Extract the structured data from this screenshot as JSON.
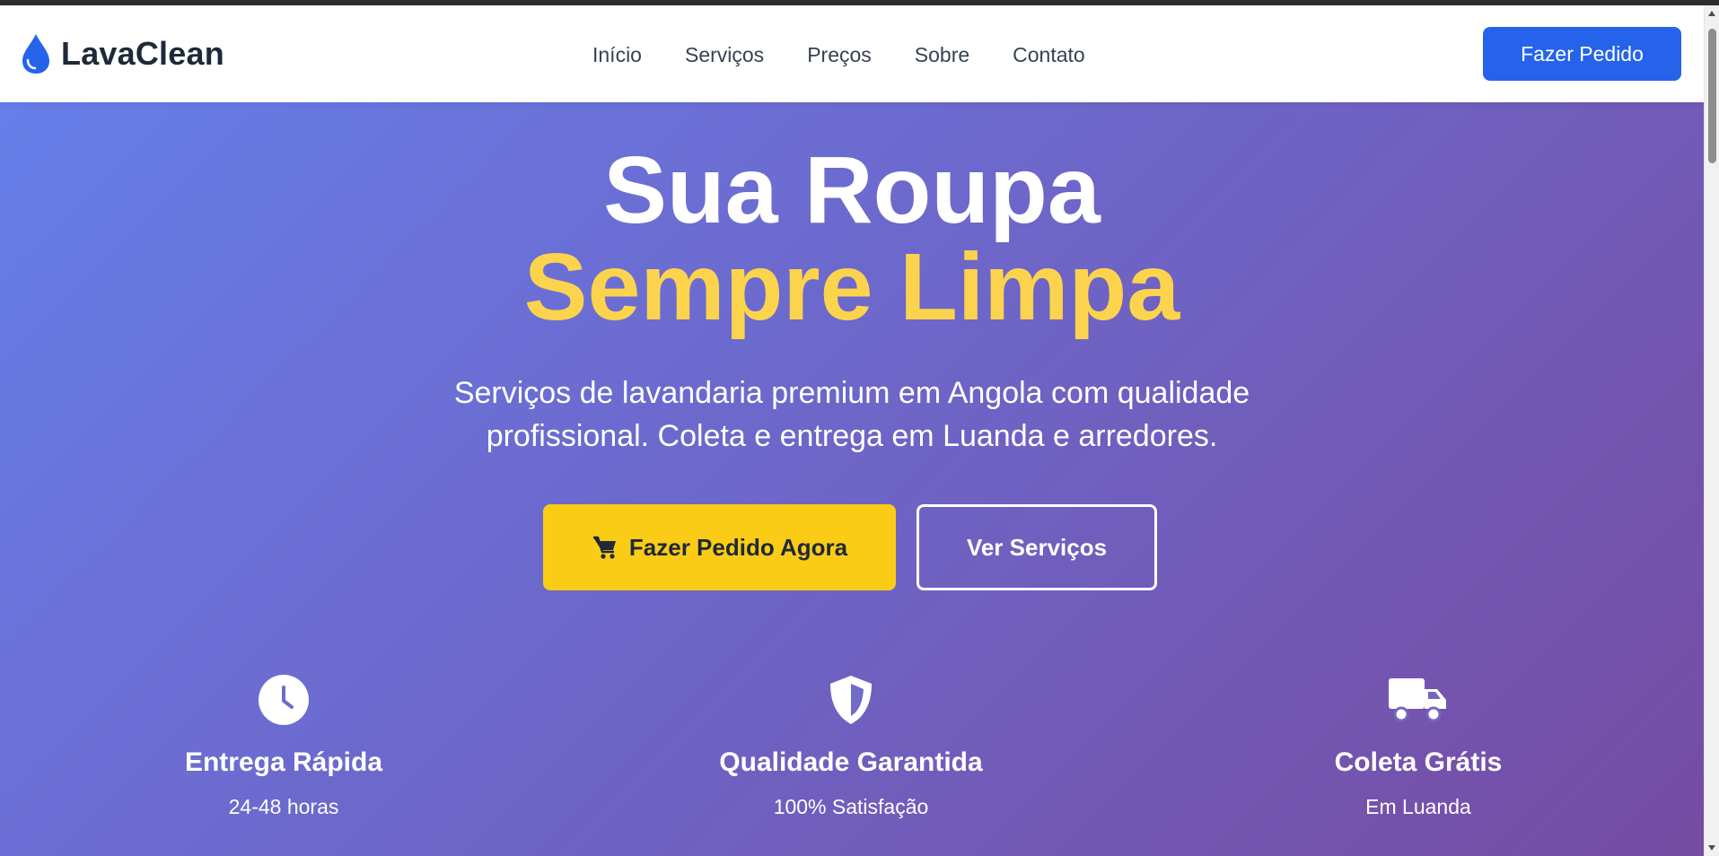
{
  "brand": {
    "name": "LavaClean",
    "icon": "water-drop-icon",
    "color": "#2563eb"
  },
  "nav": {
    "links": [
      "Início",
      "Serviços",
      "Preços",
      "Sobre",
      "Contato"
    ],
    "cta_label": "Fazer Pedido"
  },
  "hero": {
    "title_line1": "Sua Roupa",
    "title_line2": "Sempre Limpa",
    "subtitle": "Serviços de lavandaria premium em Angola com qualidade profissional. Coleta e entrega em Luanda e arredores.",
    "primary_button": {
      "label": "Fazer Pedido Agora",
      "icon": "cart-icon",
      "color": "#facc15"
    },
    "secondary_button": {
      "label": "Ver Serviços"
    },
    "gradient": [
      "#667eea",
      "#764ba2"
    ],
    "accent": "#fcd34d"
  },
  "features": [
    {
      "icon": "clock-icon",
      "title": "Entrega Rápida",
      "subtitle": "24-48 horas"
    },
    {
      "icon": "shield-icon",
      "title": "Qualidade Garantida",
      "subtitle": "100% Satisfação"
    },
    {
      "icon": "truck-icon",
      "title": "Coleta Grátis",
      "subtitle": "Em Luanda"
    }
  ]
}
